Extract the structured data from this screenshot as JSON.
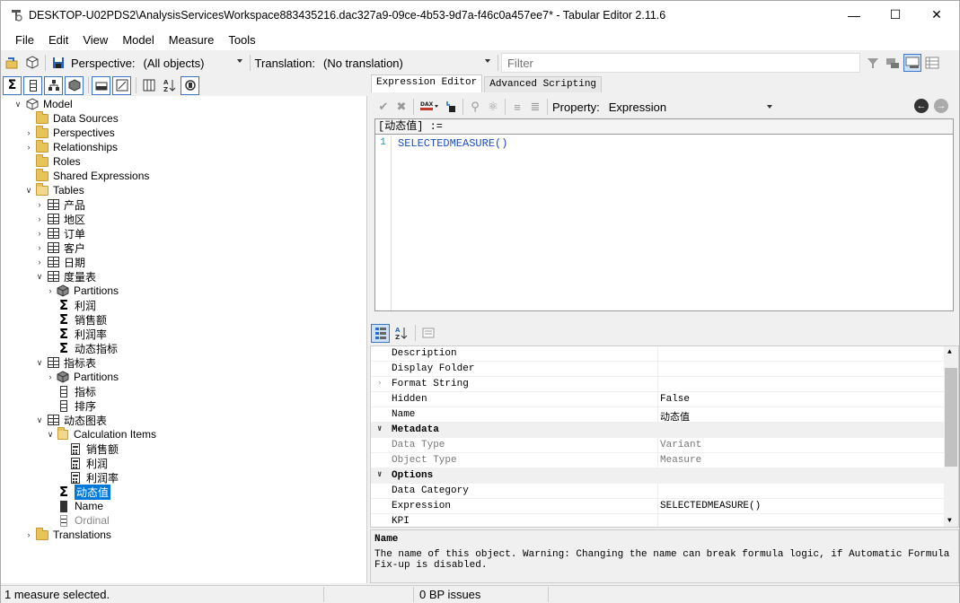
{
  "window": {
    "title": "DESKTOP-U02PDS2\\AnalysisServicesWorkspace883435216.dac327a9-09ce-4b53-9d7a-f46c0a457ee7* - Tabular Editor 2.11.6"
  },
  "menu": [
    "File",
    "Edit",
    "View",
    "Model",
    "Measure",
    "Tools"
  ],
  "toolbar": {
    "perspective_label": "Perspective:",
    "perspective_value": "(All objects)",
    "translation_label": "Translation:",
    "translation_value": "(No translation)",
    "filter_placeholder": "Filter"
  },
  "tree": {
    "model": "Model",
    "data_sources": "Data Sources",
    "perspectives": "Perspectives",
    "relationships": "Relationships",
    "roles": "Roles",
    "shared_expressions": "Shared Expressions",
    "tables": "Tables",
    "t_product": "产品",
    "t_region": "地区",
    "t_order": "订单",
    "t_customer": "客户",
    "t_date": "日期",
    "t_measures": "度量表",
    "partitions": "Partitions",
    "m_profit": "利润",
    "m_sales": "销售额",
    "m_margin": "利润率",
    "m_dynamic": "动态指标",
    "t_indicator": "指标表",
    "c_indicator": "指标",
    "c_order": "排序",
    "t_dynamic_chart": "动态图表",
    "calc_items": "Calculation Items",
    "ci_sales": "销售额",
    "ci_profit": "利润",
    "ci_margin": "利润率",
    "m_dynamic_value": "动态值",
    "c_name": "Name",
    "c_ordinal": "Ordinal",
    "translations": "Translations"
  },
  "editor": {
    "tab_expression": "Expression Editor",
    "tab_scripting": "Advanced Scripting",
    "property_label": "Property:",
    "property_value": "Expression",
    "header": "[动态值] :=",
    "line_no": "1",
    "code": "SELECTEDMEASURE()"
  },
  "properties": {
    "rows": [
      {
        "name": "Description",
        "value": ""
      },
      {
        "name": "Display Folder",
        "value": ""
      },
      {
        "name": "Format String",
        "value": ""
      },
      {
        "name": "Hidden",
        "value": "False"
      },
      {
        "name": "Name",
        "value": "动态值"
      }
    ],
    "cat_metadata": "Metadata",
    "metadata_rows": [
      {
        "name": "Data Type",
        "value": "Variant"
      },
      {
        "name": "Object Type",
        "value": "Measure"
      }
    ],
    "cat_options": "Options",
    "options_rows": [
      {
        "name": "Data Category",
        "value": ""
      },
      {
        "name": "Expression",
        "value": "SELECTEDMEASURE()"
      },
      {
        "name": "KPI",
        "value": ""
      }
    ]
  },
  "description": {
    "title": "Name",
    "text": "The name of this object. Warning: Changing the name can break formula logic, if Automatic Formula Fix-up is disabled."
  },
  "status": {
    "selection": "1 measure selected.",
    "bp_issues": "0 BP issues"
  }
}
